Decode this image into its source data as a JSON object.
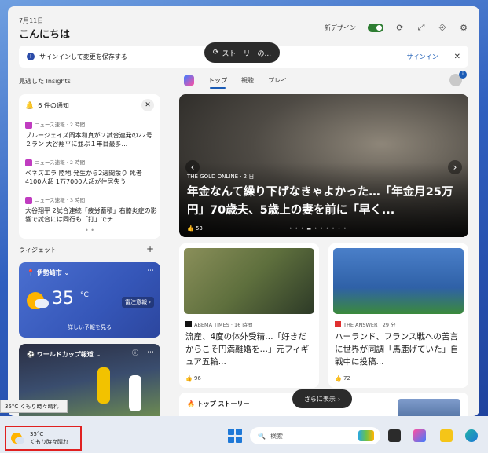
{
  "header": {
    "date": "7月11日",
    "greeting": "こんにちは",
    "new_design_label": "新デザイン",
    "new_design_on": true
  },
  "story_button": {
    "label": "ストーリーの..."
  },
  "signin_bar": {
    "message": "サインインして変更を保存する",
    "signin_label": "サインイン"
  },
  "insights": {
    "title": "見逃した Insights"
  },
  "notifications": {
    "title": "6 件の通知",
    "items": [
      {
        "source": "ニュース速報 · 2 時間",
        "text": "ブルージェイズ岡本和真が２試合連発の22号２ラン 大谷翔平に並ぶ１年目最多..."
      },
      {
        "source": "ニュース速報 · 2 時間",
        "text": "ベネズエラ 陸地 発生から2週間余り 死者4100人超 1万7000人超が住居失う"
      },
      {
        "source": "ニュース速報 · 3 時間",
        "text": "大谷翔平 2試合連続「疲労蓄積」右膝炎症の影響で試合には同行も「打」でチ..."
      }
    ],
    "dots": "• •"
  },
  "widgets": {
    "title": "ウィジェット",
    "weather": {
      "location": "伊勢崎市",
      "temperature": "35",
      "unit": "°C",
      "alert": "雷注意報",
      "link": "詳しい予報を見る"
    },
    "worldcup": {
      "title": "ワールドカップ報道"
    }
  },
  "tabs": [
    {
      "label": "トップ",
      "active": true
    },
    {
      "label": "視聴",
      "active": false
    },
    {
      "label": "プレイ",
      "active": false
    }
  ],
  "hero": {
    "source": "THE GOLD ONLINE · 2 日",
    "title": "年金なんて繰り下げなきゃよかった…「年金月25万円」70歳夫、5歳上の妻を前に「早く...",
    "likes": "53"
  },
  "cards": [
    {
      "source": "ABEMA TIMES · 16 時間",
      "title": "流産、4度の体外受精…「好きだからこそ円満離婚を…」元フィギュア五輪...",
      "likes": "96"
    },
    {
      "source": "THE ANSWER · 29 分",
      "title": "ハーランド、フランス戦への苦言に世界が同調「馬鹿げていた」自戦中に投稿...",
      "likes": "72"
    }
  ],
  "top_stories": {
    "title": "トップ ストーリー"
  },
  "more_button": {
    "label": "さらに表示"
  },
  "tooltip": {
    "text": "35°C くもり時々晴れ"
  },
  "taskbar": {
    "weather_temp": "35°C",
    "weather_desc": "くもり時々晴れ",
    "search_placeholder": "検索"
  }
}
